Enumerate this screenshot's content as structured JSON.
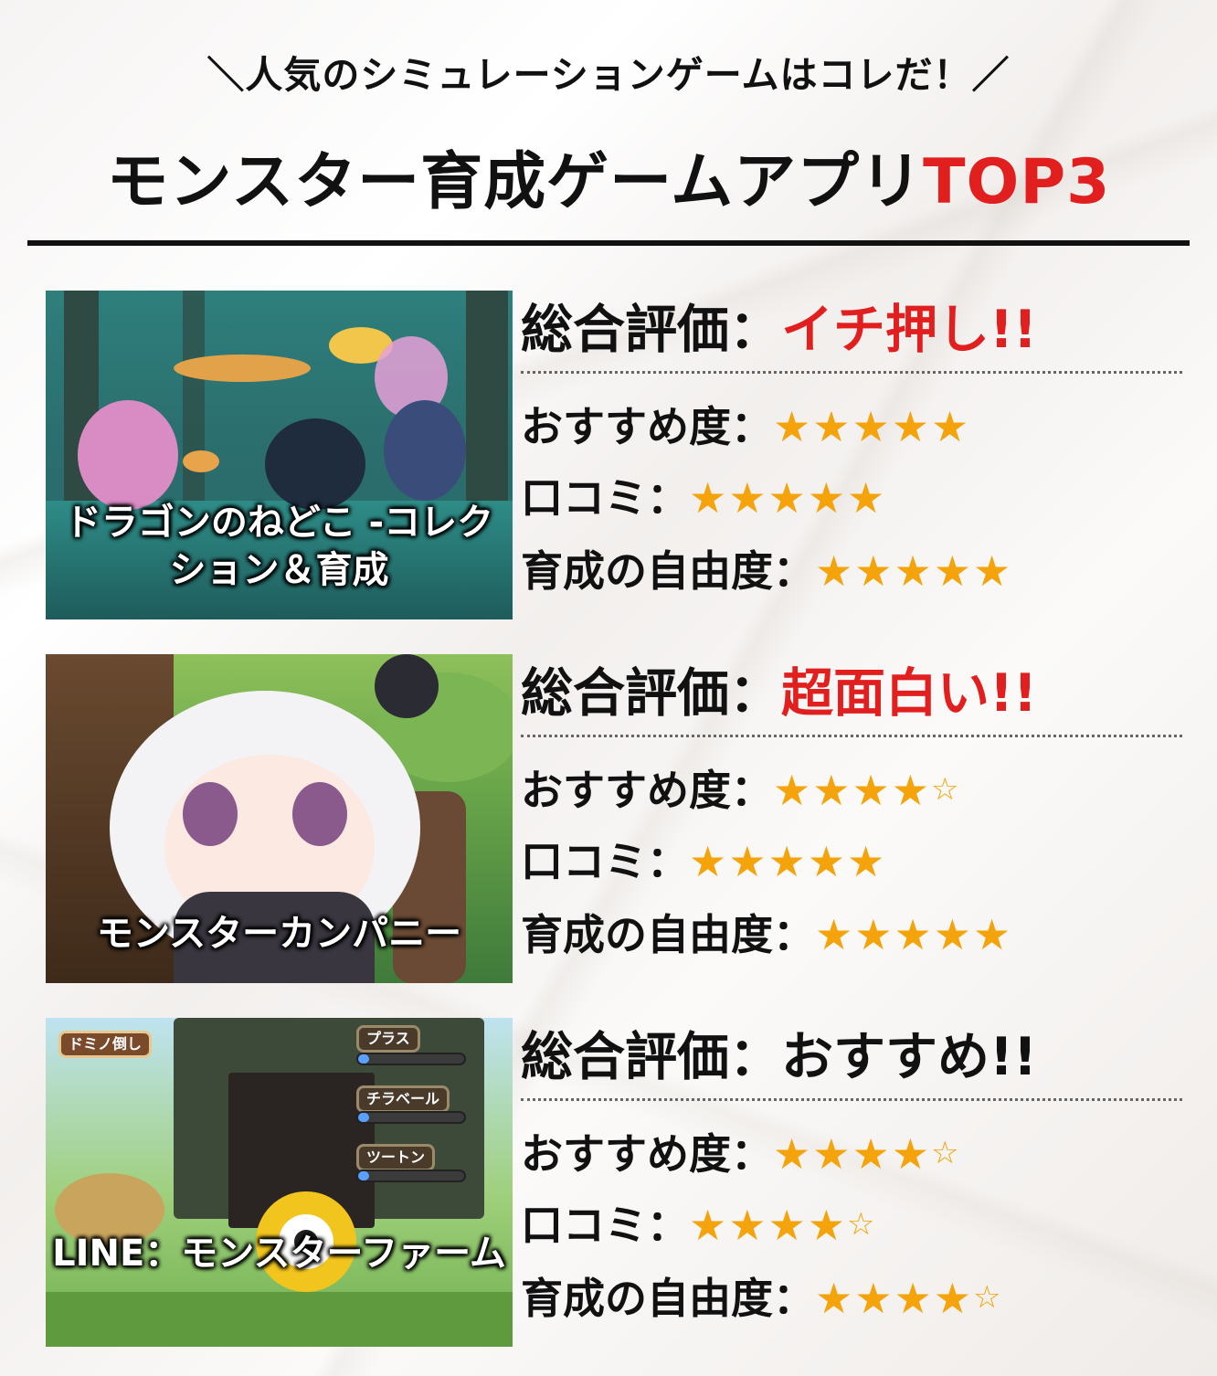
{
  "header": {
    "subtitle": "＼人気のシミュレーションゲームはコレだ！／",
    "title_main": "モンスター育成ゲームアプリ",
    "title_accent": "TOP3"
  },
  "colors": {
    "accent": "#e21f1f",
    "star": "#f4a30a",
    "text": "#111111"
  },
  "labels": {
    "overall": "総合評価：",
    "recommend": "おすすめ度：",
    "reviews": "口コミ：",
    "freedom": "育成の自由度："
  },
  "entries": [
    {
      "caption": "ドラゴンのねどこ -コレクション＆育成",
      "verdict": "イチ押し!!",
      "verdict_color": "red",
      "recommend_stars": "★★★★★",
      "recommend_empty": "",
      "reviews_stars": "★★★★★",
      "reviews_empty": "",
      "freedom_stars": "★★★★★",
      "freedom_empty": ""
    },
    {
      "caption": "モンスターカンパニー",
      "verdict": "超面白い!!",
      "verdict_color": "red",
      "recommend_stars": "★★★★",
      "recommend_empty": "☆",
      "reviews_stars": "★★★★★",
      "reviews_empty": "",
      "freedom_stars": "★★★★★",
      "freedom_empty": ""
    },
    {
      "caption": "LINE：モンスターファーム",
      "verdict": "おすすめ!!",
      "verdict_color": "black",
      "recommend_stars": "★★★★",
      "recommend_empty": "☆",
      "reviews_stars": "★★★★",
      "reviews_empty": "☆",
      "freedom_stars": "★★★★",
      "freedom_empty": "☆"
    }
  ],
  "game_hud": {
    "domino_label": "ドミノ倒し",
    "stat1": "プラス",
    "stat2": "チラベール",
    "stat3": "ツートン"
  }
}
